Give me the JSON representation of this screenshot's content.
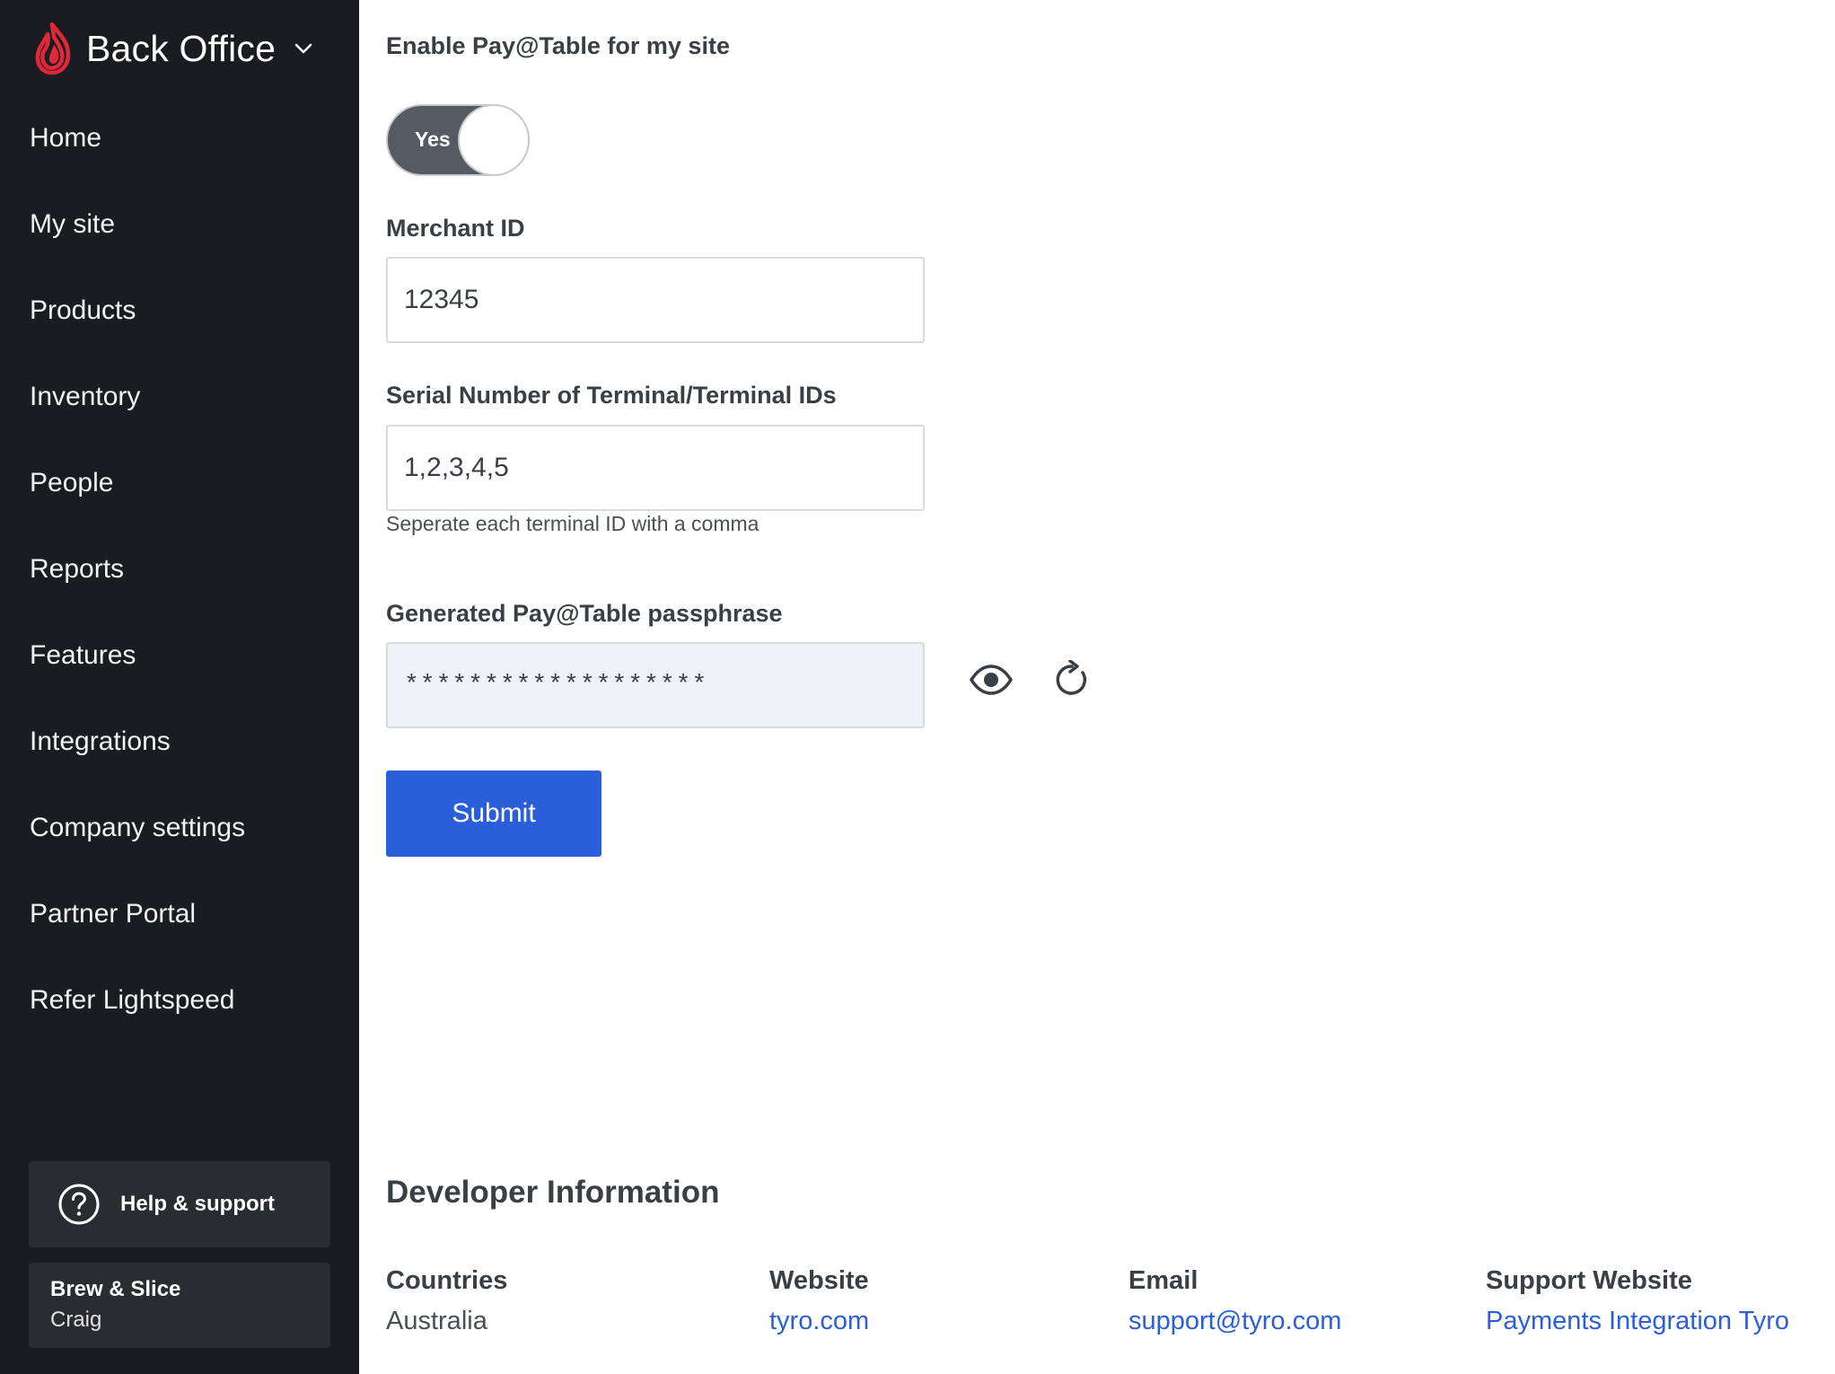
{
  "sidebar": {
    "brand": {
      "title": "Back Office",
      "logo_icon": "lightspeed-flame-icon",
      "chevron_icon": "chevron-down-icon"
    },
    "nav_items": [
      {
        "label": "Home"
      },
      {
        "label": "My site"
      },
      {
        "label": "Products"
      },
      {
        "label": "Inventory"
      },
      {
        "label": "People"
      },
      {
        "label": "Reports"
      },
      {
        "label": "Features"
      },
      {
        "label": "Integrations"
      },
      {
        "label": "Company settings"
      },
      {
        "label": "Partner Portal"
      },
      {
        "label": "Refer Lightspeed"
      }
    ],
    "help": {
      "label": "Help & support",
      "icon": "question-circle-icon"
    },
    "account": {
      "business": "Brew & Slice",
      "user": "Craig"
    }
  },
  "form": {
    "enable_label": "Enable Pay@Table for my site",
    "toggle": {
      "text": "Yes",
      "on": true
    },
    "merchant_id": {
      "label": "Merchant ID",
      "value": "12345"
    },
    "terminals": {
      "label": "Serial Number of Terminal/Terminal IDs",
      "value": "1,2,3,4,5",
      "hint": "Seperate each terminal ID with a comma"
    },
    "passphrase": {
      "label": "Generated Pay@Table passphrase",
      "value": "*******************",
      "show_icon": "eye-icon",
      "regenerate_icon": "refresh-icon"
    },
    "submit_label": "Submit"
  },
  "developer": {
    "title": "Developer Information",
    "countries": {
      "label": "Countries",
      "value": "Australia"
    },
    "website": {
      "label": "Website",
      "value": "tyro.com"
    },
    "email": {
      "label": "Email",
      "value": "support@tyro.com"
    },
    "support_website": {
      "label": "Support Website",
      "value": "Payments Integration Tyro"
    }
  },
  "colors": {
    "sidebar_bg": "#1b1c1f",
    "accent_blue": "#2b5fd9",
    "brand_red": "#e0283a",
    "toggle_on": "#555b63"
  }
}
